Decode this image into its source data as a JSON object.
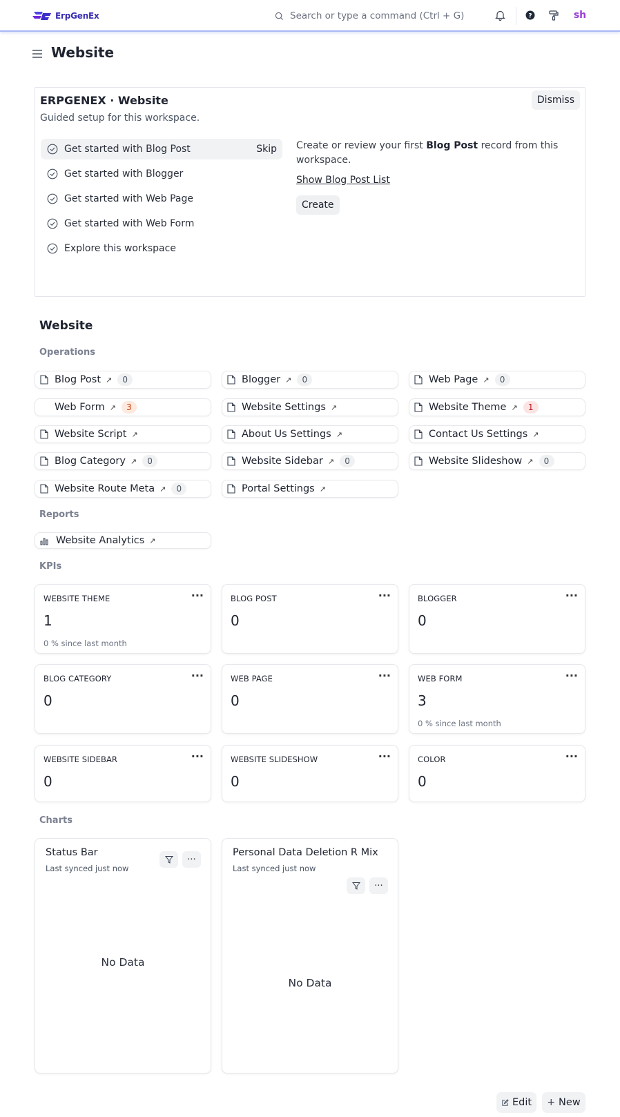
{
  "navbar": {
    "logo_text": "ErpGenEx",
    "search_placeholder": "Search or type a command (Ctrl + G)",
    "avatar_initials": "sh"
  },
  "page": {
    "title": "Website"
  },
  "onboarding": {
    "title": "ERPGENEX · Website",
    "subtitle": "Guided setup for this workspace.",
    "dismiss_label": "Dismiss",
    "steps": [
      {
        "label": "Get started with Blog Post"
      },
      {
        "label": "Get started with Blogger"
      },
      {
        "label": "Get started with Web Page"
      },
      {
        "label": "Get started with Web Form"
      },
      {
        "label": "Explore this workspace"
      }
    ],
    "skip_label": "Skip",
    "desc_prefix": "Create or review your first ",
    "desc_bold": "Blog Post",
    "desc_suffix": " record from this workspace.",
    "link_label": "Show Blog Post List",
    "create_label": "Create"
  },
  "workspace": {
    "section_title": "Website",
    "operations_label": "Operations",
    "reports_label": "Reports",
    "kpis_label": "KPIs",
    "charts_label": "Charts"
  },
  "operations": [
    {
      "label": "Blog Post",
      "count": "0"
    },
    {
      "label": "Blogger",
      "count": "0"
    },
    {
      "label": "Web Page",
      "count": "0"
    },
    {
      "label": "Web Form",
      "count": "3"
    },
    {
      "label": "Website Settings"
    },
    {
      "label": "Website Theme",
      "count": "1"
    },
    {
      "label": "Website Script"
    },
    {
      "label": "About Us Settings"
    },
    {
      "label": "Contact Us Settings"
    },
    {
      "label": "Blog Category",
      "count": "0"
    },
    {
      "label": "Website Sidebar",
      "count": "0"
    },
    {
      "label": "Website Slideshow",
      "count": "0"
    },
    {
      "label": "Website Route Meta",
      "count": "0"
    },
    {
      "label": "Portal Settings"
    }
  ],
  "reports": [
    {
      "label": "Website Analytics"
    }
  ],
  "kpis": [
    {
      "label": "WEBSITE THEME",
      "value": "1",
      "note": "0 % since last month"
    },
    {
      "label": "BLOG POST",
      "value": "0"
    },
    {
      "label": "BLOGGER",
      "value": "0"
    },
    {
      "label": "BLOG CATEGORY",
      "value": "0"
    },
    {
      "label": "WEB PAGE",
      "value": "0"
    },
    {
      "label": "WEB FORM",
      "value": "3",
      "note": "0 % since last month"
    },
    {
      "label": "WEBSITE SIDEBAR",
      "value": "0"
    },
    {
      "label": "WEBSITE SLIDESHOW",
      "value": "0"
    },
    {
      "label": "COLOR",
      "value": "0"
    }
  ],
  "kpi_menu_glyph": "···",
  "charts": [
    {
      "title": "Status Bar",
      "synced": "Last synced just now",
      "empty": "No Data"
    },
    {
      "title": "Personal Data Deletion R Mix",
      "synced": "Last synced just now",
      "empty": "No Data"
    }
  ],
  "actions": {
    "edit_label": "Edit",
    "new_label": "New"
  },
  "colors": {
    "brand": "#3a2fb0",
    "navbar_border": "#a9b9f6",
    "avatar": "#9a3fd6"
  }
}
